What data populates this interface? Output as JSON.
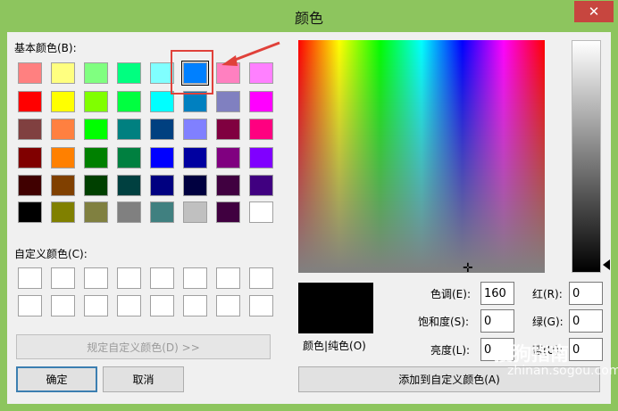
{
  "window": {
    "title": "颜色",
    "close_glyph": "✕"
  },
  "basic_label": "基本颜色(B):",
  "custom_label": "自定义颜色(C):",
  "basic_colors": [
    [
      "#ff8080",
      "#ffff80",
      "#80ff80",
      "#00ff80",
      "#80ffff",
      "#0080ff",
      "#ff80c0",
      "#ff80ff"
    ],
    [
      "#ff0000",
      "#ffff00",
      "#80ff00",
      "#00ff40",
      "#00ffff",
      "#0080c0",
      "#8080c0",
      "#ff00ff"
    ],
    [
      "#804040",
      "#ff8040",
      "#00ff00",
      "#008080",
      "#004080",
      "#8080ff",
      "#800040",
      "#ff0080"
    ],
    [
      "#800000",
      "#ff8000",
      "#008000",
      "#008040",
      "#0000ff",
      "#0000a0",
      "#800080",
      "#8000ff"
    ],
    [
      "#400000",
      "#804000",
      "#004000",
      "#004040",
      "#000080",
      "#000040",
      "#400040",
      "#400080"
    ],
    [
      "#000000",
      "#808000",
      "#808040",
      "#808080",
      "#408080",
      "#c0c0c0",
      "#400040",
      "#ffffff"
    ]
  ],
  "selected_swatch": "5,0",
  "define_custom_btn": "规定自定义颜色(D) >>",
  "ok_btn": "确定",
  "cancel_btn": "取消",
  "color_solid_label": "颜色|纯色(O)",
  "fields": {
    "hue": {
      "label": "色调(E):",
      "value": "160"
    },
    "sat": {
      "label": "饱和度(S):",
      "value": "0"
    },
    "lum": {
      "label": "亮度(L):",
      "value": "0"
    },
    "red": {
      "label": "红(R):",
      "value": "0"
    },
    "green": {
      "label": "绿(G):",
      "value": "0"
    },
    "blue": {
      "label": "蓝(U):",
      "value": "0"
    }
  },
  "add_custom_btn": "添加到自定义颜色(A)",
  "watermark": {
    "main": "搜狗指南",
    "sub": "zhinan.sogou.com"
  },
  "colors": {
    "highlight": "#e0413a",
    "titlebar": "#8dc55e",
    "close": "#c7463f"
  }
}
